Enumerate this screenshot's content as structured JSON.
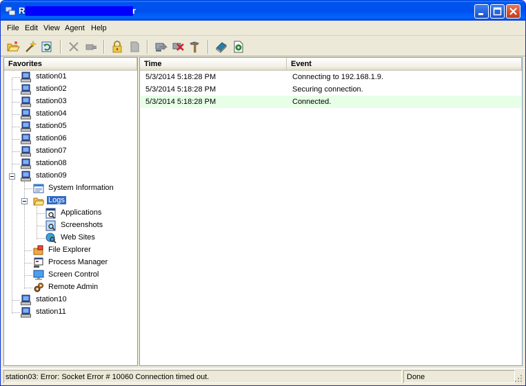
{
  "window": {
    "title_prefix": "R",
    "title_suffix": "r"
  },
  "menu": {
    "items": [
      "File",
      "Edit",
      "View",
      "Agent",
      "Help"
    ]
  },
  "toolbar": {
    "icons": [
      "open-folder-icon",
      "connect-wand-icon",
      "refresh-icon",
      "delete-icon",
      "disconnect-icon",
      "lock-icon",
      "page-icon",
      "send-icon",
      "stop-icon",
      "tools-icon",
      "book-icon",
      "export-icon"
    ]
  },
  "favorites": {
    "header": "Favorites",
    "stations_top": [
      "station01",
      "station02",
      "station03",
      "station04",
      "station05",
      "station06",
      "station07",
      "station08"
    ],
    "expanded_station": "station09",
    "children": {
      "system_information": "System Information",
      "logs": "Logs",
      "applications": "Applications",
      "screenshots": "Screenshots",
      "web_sites": "Web Sites",
      "file_explorer": "File Explorer",
      "process_manager": "Process Manager",
      "screen_control": "Screen Control",
      "remote_admin": "Remote Admin"
    },
    "stations_bottom": [
      "station10",
      "station11"
    ]
  },
  "log": {
    "headers": {
      "time": "Time",
      "event": "Event"
    },
    "rows": [
      {
        "time": "5/3/2014 5:18:28 PM",
        "event": "Connecting to 192.168.1.9."
      },
      {
        "time": "5/3/2014 5:18:28 PM",
        "event": "Securing connection."
      },
      {
        "time": "5/3/2014 5:18:28 PM",
        "event": "Connected."
      }
    ]
  },
  "status": {
    "message": "station03: Error: Socket Error # 10060 Connection timed out.",
    "state": "Done"
  }
}
